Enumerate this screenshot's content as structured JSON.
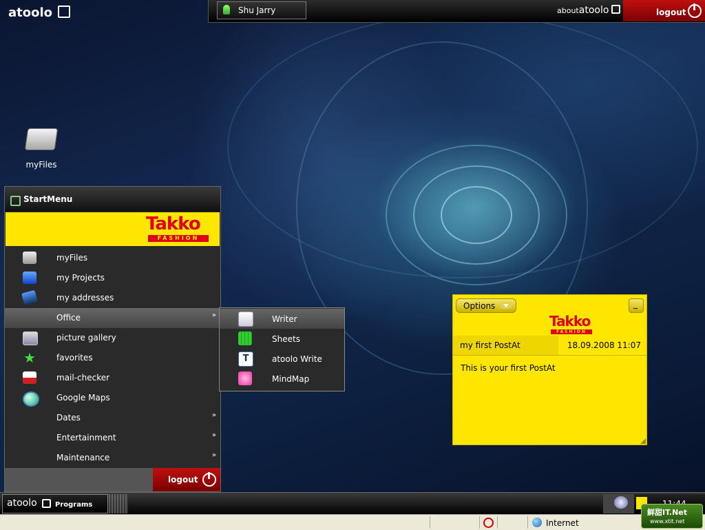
{
  "brand": {
    "name": "atoolo",
    "about_prefix": "about",
    "about_name": "atoolo"
  },
  "user": {
    "name": "Shu Jarry"
  },
  "topbar": {
    "logout_label": "logout"
  },
  "desktop": {
    "icons": [
      {
        "label": "myFiles",
        "icon": "drive-icon"
      }
    ]
  },
  "startmenu": {
    "title": "StartMenu",
    "logo": {
      "text": "Takko",
      "sub": "FASHION"
    },
    "items": [
      {
        "label": "myFiles",
        "icon": "drive-icon",
        "has_submenu": false
      },
      {
        "label": "my Projects",
        "icon": "projects-icon",
        "has_submenu": false
      },
      {
        "label": "my addresses",
        "icon": "address-book-icon",
        "has_submenu": false
      },
      {
        "label": "Office",
        "icon": "",
        "has_submenu": true
      },
      {
        "label": "picture gallery",
        "icon": "picture-icon",
        "has_submenu": false
      },
      {
        "label": "favorites",
        "icon": "star-icon",
        "has_submenu": false
      },
      {
        "label": "mail-checker",
        "icon": "mailbox-icon",
        "has_submenu": false
      },
      {
        "label": "Google Maps",
        "icon": "globe-icon",
        "has_submenu": false
      },
      {
        "label": "Dates",
        "icon": "",
        "has_submenu": true
      },
      {
        "label": "Entertainment",
        "icon": "",
        "has_submenu": true
      },
      {
        "label": "Maintenance",
        "icon": "",
        "has_submenu": true
      }
    ],
    "arrow_glyph": "»",
    "logout_label": "logout"
  },
  "submenu": {
    "items": [
      {
        "label": "Writer",
        "icon": "writer-icon"
      },
      {
        "label": "Sheets",
        "icon": "sheets-icon"
      },
      {
        "label": "atoolo Write",
        "icon": "atoolo-write-icon"
      },
      {
        "label": "MindMap",
        "icon": "mindmap-icon"
      }
    ]
  },
  "postit": {
    "options_label": "Options",
    "minimize_label": "_",
    "logo": {
      "text": "Takko",
      "sub": "FASHION"
    },
    "title": "my first PostAt",
    "date": "18.09.2008 11:07",
    "body": "This is your first PostAt"
  },
  "taskbar": {
    "programs_label": "Programs",
    "clock": "11:44"
  },
  "statusbar": {
    "zone": "Internet"
  },
  "watermark": {
    "line1": "鲜甜IT.Net",
    "line2": "www.xtit.net"
  },
  "colors": {
    "accent_red": "#c01010",
    "postit_yellow": "#ffe600",
    "takko_red": "#e0001a"
  }
}
